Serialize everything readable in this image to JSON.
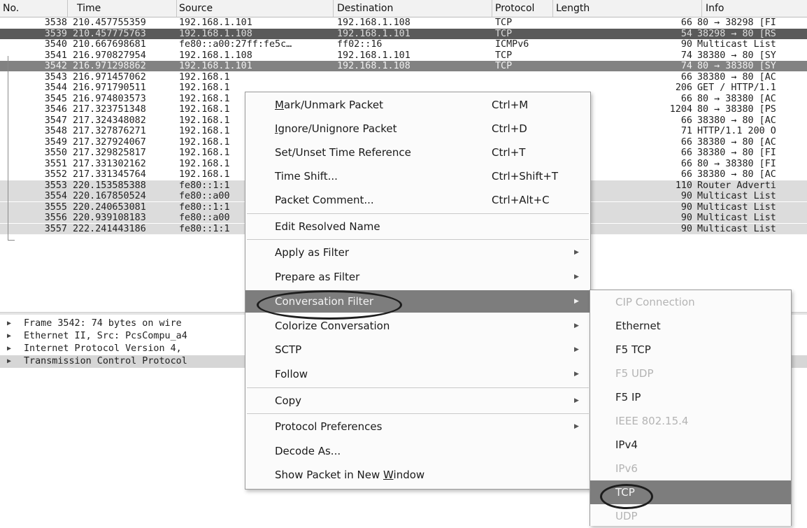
{
  "columns": [
    "No.",
    "Time",
    "Source",
    "Destination",
    "Protocol",
    "Length",
    "Info"
  ],
  "packets": [
    {
      "no": "3538",
      "time": "210.457755359",
      "src": "192.168.1.101",
      "dst": "192.168.1.108",
      "proto": "TCP",
      "len": "66",
      "info": "80 → 38298 [FI"
    },
    {
      "no": "3539",
      "time": "210.457775763",
      "src": "192.168.1.108",
      "dst": "192.168.1.101",
      "proto": "TCP",
      "len": "54",
      "info": "38298 → 80 [RS"
    },
    {
      "no": "3540",
      "time": "210.667698681",
      "src": "fe80::a00:27ff:fe5c…",
      "dst": "ff02::16",
      "proto": "ICMPv6",
      "len": "90",
      "info": "Multicast List"
    },
    {
      "no": "3541",
      "time": "216.970827954",
      "src": "192.168.1.108",
      "dst": "192.168.1.101",
      "proto": "TCP",
      "len": "74",
      "info": "38380 → 80 [SY"
    },
    {
      "no": "3542",
      "time": "216.971298862",
      "src": "192.168.1.101",
      "dst": "192.168.1.108",
      "proto": "TCP",
      "len": "74",
      "info": "80 → 38380 [SY"
    },
    {
      "no": "3543",
      "time": "216.971457062",
      "src": "192.168.1",
      "dst": "",
      "proto": "",
      "len": "66",
      "info": "38380 → 80 [AC"
    },
    {
      "no": "3544",
      "time": "216.971790511",
      "src": "192.168.1",
      "dst": "",
      "proto": "",
      "len": "206",
      "info": "GET / HTTP/1.1"
    },
    {
      "no": "3545",
      "time": "216.974803573",
      "src": "192.168.1",
      "dst": "",
      "proto": "",
      "len": "66",
      "info": "80 → 38380 [AC"
    },
    {
      "no": "3546",
      "time": "217.323751348",
      "src": "192.168.1",
      "dst": "",
      "proto": "",
      "len": "1204",
      "info": "80 → 38380 [PS"
    },
    {
      "no": "3547",
      "time": "217.324348082",
      "src": "192.168.1",
      "dst": "",
      "proto": "",
      "len": "66",
      "info": "38380 → 80 [AC"
    },
    {
      "no": "3548",
      "time": "217.327876271",
      "src": "192.168.1",
      "dst": "",
      "proto": "",
      "len": "71",
      "info": "HTTP/1.1 200 O"
    },
    {
      "no": "3549",
      "time": "217.327924067",
      "src": "192.168.1",
      "dst": "",
      "proto": "",
      "len": "66",
      "info": "38380 → 80 [AC"
    },
    {
      "no": "3550",
      "time": "217.329825817",
      "src": "192.168.1",
      "dst": "",
      "proto": "",
      "len": "66",
      "info": "38380 → 80 [FI"
    },
    {
      "no": "3551",
      "time": "217.331302162",
      "src": "192.168.1",
      "dst": "",
      "proto": "",
      "len": "66",
      "info": "80 → 38380 [FI"
    },
    {
      "no": "3552",
      "time": "217.331345764",
      "src": "192.168.1",
      "dst": "",
      "proto": "",
      "len": "66",
      "info": "38380 → 80 [AC"
    },
    {
      "no": "3553",
      "time": "220.153585388",
      "src": "fe80::1:1",
      "dst": "",
      "proto": "",
      "len": "110",
      "info": "Router Adverti"
    },
    {
      "no": "3554",
      "time": "220.167850524",
      "src": "fe80::a00",
      "dst": "",
      "proto": "",
      "len": "90",
      "info": "Multicast List"
    },
    {
      "no": "3555",
      "time": "220.240653081",
      "src": "fe80::1:1",
      "dst": "",
      "proto": "",
      "len": "90",
      "info": "Multicast List"
    },
    {
      "no": "3556",
      "time": "220.939108183",
      "src": "fe80::a00",
      "dst": "",
      "proto": "",
      "len": "90",
      "info": "Multicast List"
    },
    {
      "no": "3557",
      "time": "222.241443186",
      "src": "fe80::1:1",
      "dst": "",
      "proto": "",
      "len": "90",
      "info": "Multicast List"
    }
  ],
  "details": [
    "Frame 3542: 74 bytes on wire",
    "Ethernet II, Src: PcsCompu_a4",
    "Internet Protocol Version 4,",
    "Transmission Control Protocol"
  ],
  "context_menu": {
    "mark": {
      "pre": "",
      "u": "M",
      "post": "ark/Unmark Packet",
      "shortcut": "Ctrl+M"
    },
    "ignore": {
      "pre": "",
      "u": "I",
      "post": "gnore/Unignore Packet",
      "shortcut": "Ctrl+D"
    },
    "timeref": {
      "label": "Set/Unset Time Reference",
      "shortcut": "Ctrl+T"
    },
    "timeshift": {
      "label": "Time Shift...",
      "shortcut": "Ctrl+Shift+T"
    },
    "comment": {
      "label": "Packet Comment...",
      "shortcut": "Ctrl+Alt+C"
    },
    "resolved": {
      "label": "Edit Resolved Name"
    },
    "apply": {
      "label": "Apply as Filter"
    },
    "prepare": {
      "label": "Prepare as Filter"
    },
    "conversation": {
      "label": "Conversation Filter"
    },
    "colorize": {
      "label": "Colorize Conversation"
    },
    "sctp": {
      "label": "SCTP"
    },
    "follow": {
      "label": "Follow"
    },
    "copy": {
      "label": "Copy"
    },
    "prefs": {
      "label": "Protocol Preferences"
    },
    "decode": {
      "label": "Decode As..."
    },
    "newwin": {
      "pre": "Show Packet in New ",
      "u": "W",
      "post": "indow"
    }
  },
  "submenu": [
    {
      "label": "CIP Connection",
      "enabled": false
    },
    {
      "label": "Ethernet",
      "enabled": true
    },
    {
      "label": "F5 TCP",
      "enabled": true
    },
    {
      "label": "F5 UDP",
      "enabled": false
    },
    {
      "label": "F5 IP",
      "enabled": true
    },
    {
      "label": "IEEE 802.15.4",
      "enabled": false
    },
    {
      "label": "IPv4",
      "enabled": true
    },
    {
      "label": "IPv6",
      "enabled": false
    },
    {
      "label": "TCP",
      "enabled": true
    },
    {
      "label": "UDP",
      "enabled": false
    }
  ],
  "icons": {
    "expand": "triangle-right-icon",
    "submenu": "triangle-right-icon"
  },
  "colors": {
    "selected_row": "#5a5a5a",
    "active_row": "#828282",
    "menu_highlight": "#7d7d7d"
  }
}
